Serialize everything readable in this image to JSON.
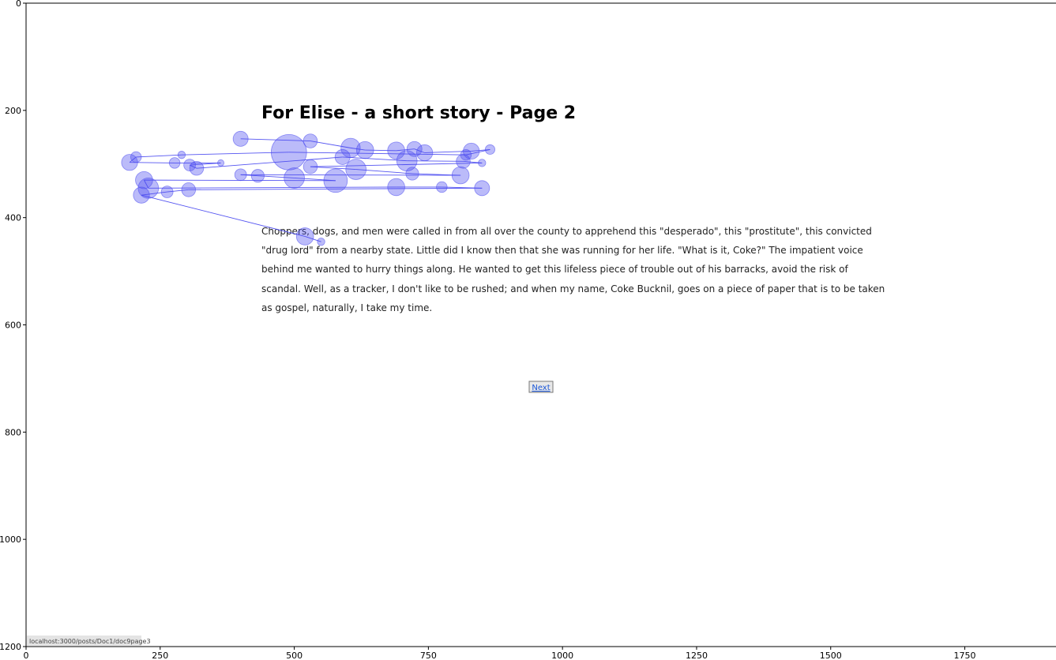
{
  "chart_data": {
    "type": "scatter",
    "xlim": [
      0,
      1920
    ],
    "ylim": [
      1200,
      0
    ],
    "xticks": [
      0,
      250,
      500,
      750,
      1000,
      1250,
      1500,
      1750
    ],
    "yticks": [
      0,
      200,
      400,
      600,
      800,
      1000,
      1200
    ],
    "grid": false,
    "background_page": {
      "title": "For Elise - a short story - Page 2",
      "paragraph_lines": [
        "Choppers, dogs, and men were called in from all over the county to apprehend this \"desperado\", this \"prostitute\", this convicted",
        "\"drug lord\" from a nearby state. Little did I know then that she was running for her life. \"What is it, Coke?\" The impatient voice",
        "behind me wanted to hurry things along. He wanted to get this lifeless piece of trouble out of his barracks, avoid the risk of",
        "scandal. Well, as a tracker, I don't like to be rushed; and when my name, Coke Bucknil, goes on a piece of paper that is to be taken",
        "as gospel, naturally, I take my time."
      ],
      "next_link": "Next",
      "status_url": "localhost:3000/posts/Doc1/doc9page3"
    },
    "fixation_color": "#4b4bf0",
    "series": [
      {
        "points": [
          {
            "x": 400,
            "y": 253,
            "r": 14
          },
          {
            "x": 530,
            "y": 257,
            "r": 13
          },
          {
            "x": 605,
            "y": 270,
            "r": 18
          },
          {
            "x": 632,
            "y": 274,
            "r": 16
          },
          {
            "x": 690,
            "y": 275,
            "r": 16
          },
          {
            "x": 724,
            "y": 272,
            "r": 14
          },
          {
            "x": 743,
            "y": 279,
            "r": 15
          },
          {
            "x": 830,
            "y": 276,
            "r": 15
          },
          {
            "x": 865,
            "y": 273,
            "r": 9
          },
          {
            "x": 820,
            "y": 283,
            "r": 10
          },
          {
            "x": 490,
            "y": 278,
            "r": 33
          },
          {
            "x": 290,
            "y": 283,
            "r": 7
          },
          {
            "x": 205,
            "y": 287,
            "r": 10
          },
          {
            "x": 193,
            "y": 297,
            "r": 15
          },
          {
            "x": 277,
            "y": 298,
            "r": 10
          },
          {
            "x": 363,
            "y": 298,
            "r": 6
          },
          {
            "x": 305,
            "y": 302,
            "r": 11
          },
          {
            "x": 318,
            "y": 308,
            "r": 13
          },
          {
            "x": 590,
            "y": 287,
            "r": 14
          },
          {
            "x": 710,
            "y": 294,
            "r": 19
          },
          {
            "x": 815,
            "y": 295,
            "r": 13
          },
          {
            "x": 850,
            "y": 298,
            "r": 7
          },
          {
            "x": 530,
            "y": 305,
            "r": 13
          },
          {
            "x": 615,
            "y": 310,
            "r": 19
          },
          {
            "x": 720,
            "y": 318,
            "r": 12
          },
          {
            "x": 810,
            "y": 321,
            "r": 16
          },
          {
            "x": 400,
            "y": 320,
            "r": 11
          },
          {
            "x": 432,
            "y": 322,
            "r": 12
          },
          {
            "x": 500,
            "y": 326,
            "r": 19
          },
          {
            "x": 577,
            "y": 331,
            "r": 22
          },
          {
            "x": 220,
            "y": 330,
            "r": 16
          },
          {
            "x": 228,
            "y": 345,
            "r": 19
          },
          {
            "x": 690,
            "y": 343,
            "r": 16
          },
          {
            "x": 775,
            "y": 343,
            "r": 10
          },
          {
            "x": 850,
            "y": 345,
            "r": 14
          },
          {
            "x": 303,
            "y": 348,
            "r": 13
          },
          {
            "x": 263,
            "y": 352,
            "r": 11
          },
          {
            "x": 215,
            "y": 358,
            "r": 15
          },
          {
            "x": 520,
            "y": 435,
            "r": 16
          },
          {
            "x": 550,
            "y": 445,
            "r": 7
          }
        ]
      }
    ]
  }
}
